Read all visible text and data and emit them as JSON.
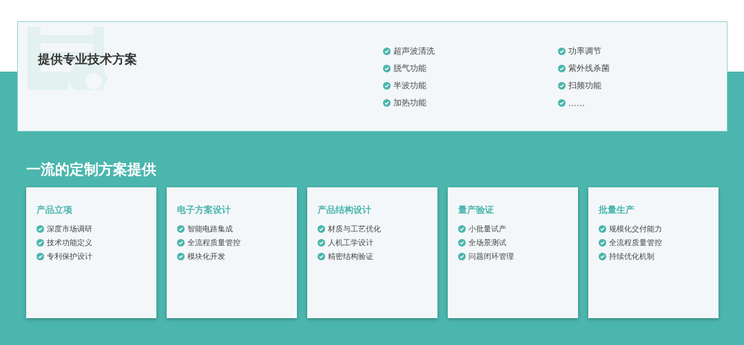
{
  "intro": {
    "title": "提供专业技术方案",
    "features": [
      "超声波清洗",
      "脱气功能",
      "半波功能",
      "加热功能",
      "功率调节",
      "紫外线杀菌",
      "扫频功能",
      "……"
    ]
  },
  "section_title": "一流的定制方案提供",
  "steps": [
    {
      "title": "产品立项",
      "items": [
        "深度市场调研",
        "技术功能定义",
        "专利保护设计"
      ]
    },
    {
      "title": "电子方案设计",
      "items": [
        "智能电路集成",
        "全流程质量管控",
        "模块化开发"
      ]
    },
    {
      "title": "产品结构设计",
      "items": [
        "材质与工艺优化",
        "人机工学设计",
        "精密结构验证"
      ]
    },
    {
      "title": "量产验证",
      "items": [
        "小批量试产",
        "全场景测试",
        "问题闭环管理"
      ]
    },
    {
      "title": "批量生产",
      "items": [
        "规模化交付能力",
        "全流程质量管控",
        "持续优化机制"
      ]
    }
  ]
}
